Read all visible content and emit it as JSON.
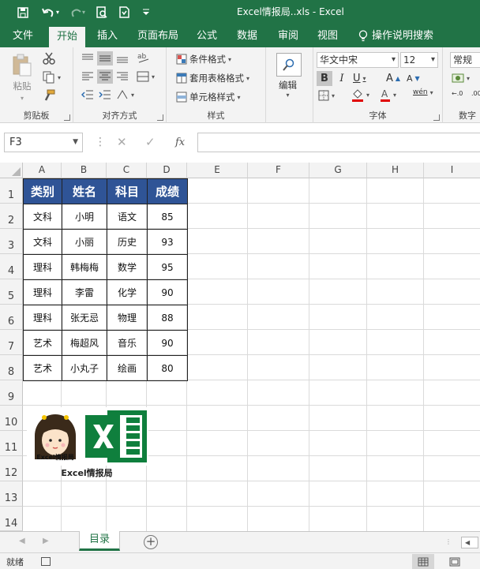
{
  "titlebar": {
    "title": "Excel情报局..xls  -  Excel",
    "bg": "#217346"
  },
  "tabs": [
    {
      "label": "文件"
    },
    {
      "label": "开始",
      "active": true
    },
    {
      "label": "插入"
    },
    {
      "label": "页面布局"
    },
    {
      "label": "公式"
    },
    {
      "label": "数据"
    },
    {
      "label": "审阅"
    },
    {
      "label": "视图"
    },
    {
      "label": "操作说明搜索"
    }
  ],
  "ribbon": {
    "clipboard": {
      "paste": "粘贴",
      "label": "剪贴板"
    },
    "alignment": {
      "label": "对齐方式"
    },
    "styles": {
      "conditional": "条件格式",
      "table_format": "套用表格格式",
      "cell_styles": "单元格样式",
      "label": "样式"
    },
    "editing": {
      "label": "编辑"
    },
    "font": {
      "name": "华文中宋",
      "size": "12",
      "label": "字体"
    },
    "number": {
      "format": "常规",
      "label": "数字"
    }
  },
  "formula_bar": {
    "name_box": "F3",
    "fx": "fx",
    "value": ""
  },
  "columns": [
    "A",
    "B",
    "C",
    "D",
    "E",
    "F",
    "G",
    "H",
    "I"
  ],
  "rows": [
    "1",
    "2",
    "3",
    "4",
    "5",
    "6",
    "7",
    "8",
    "9",
    "10",
    "11",
    "12",
    "13",
    "14"
  ],
  "table": {
    "header_bg": "#2f5496",
    "headers": [
      "类别",
      "姓名",
      "科目",
      "成绩"
    ],
    "rows": [
      [
        "文科",
        "小明",
        "语文",
        "85"
      ],
      [
        "文科",
        "小丽",
        "历史",
        "93"
      ],
      [
        "理科",
        "韩梅梅",
        "数学",
        "95"
      ],
      [
        "理科",
        "李雷",
        "化学",
        "90"
      ],
      [
        "理科",
        "张无忌",
        "物理",
        "88"
      ],
      [
        "艺术",
        "梅超风",
        "音乐",
        "90"
      ],
      [
        "艺术",
        "小丸子",
        "绘画",
        "80"
      ]
    ]
  },
  "pictures": {
    "avatar_text": "Excel情报局",
    "caption": "Excel情报局"
  },
  "sheets": {
    "active": "目录"
  },
  "status": {
    "text": "就绪"
  }
}
